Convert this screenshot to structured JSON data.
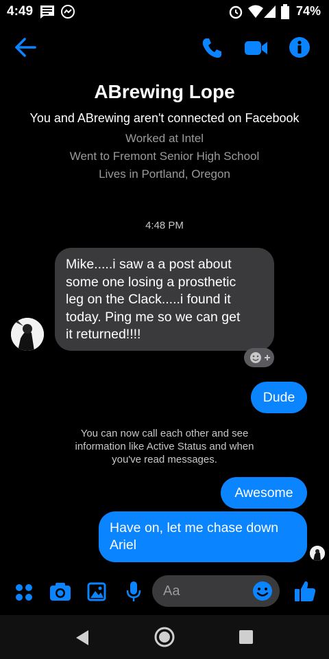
{
  "status_bar": {
    "time": "4:49",
    "battery": "74%",
    "icons": [
      "message-notification-icon",
      "messenger-icon",
      "alarm-icon",
      "wifi-icon",
      "signal-icon",
      "battery-icon"
    ]
  },
  "header": {
    "icons": [
      "back-arrow-icon",
      "phone-icon",
      "video-icon",
      "info-icon"
    ],
    "accent_color": "#0a84ff"
  },
  "profile": {
    "name": "ABrewing Lope",
    "connection_note": "You and ABrewing aren't connected on Facebook",
    "details": [
      "Worked at Intel",
      "Went to Fremont Senior High School",
      "Lives in Portland, Oregon"
    ]
  },
  "conversation": {
    "timestamp": "4:48 PM",
    "incoming_lines": [
      "Mike.....i saw a a post about",
      "some one losing a prosthetic",
      "leg on the Clack.....i found it",
      "today.  Ping me so we can get",
      "it returned!!!!"
    ],
    "out_1": "Dude",
    "system_lines": [
      "You can now call each other and see",
      "information like Active Status and when",
      "you've read messages."
    ],
    "out_2": "Awesome",
    "out_3_lines": [
      "Have on, let me chase down",
      "Ariel"
    ]
  },
  "composer": {
    "placeholder": "Aa",
    "icons": [
      "apps-icon",
      "camera-icon",
      "gallery-icon",
      "microphone-icon",
      "emoji-icon",
      "like-icon"
    ]
  },
  "nav": {
    "icons": [
      "back-nav-icon",
      "home-nav-icon",
      "recents-nav-icon"
    ]
  }
}
